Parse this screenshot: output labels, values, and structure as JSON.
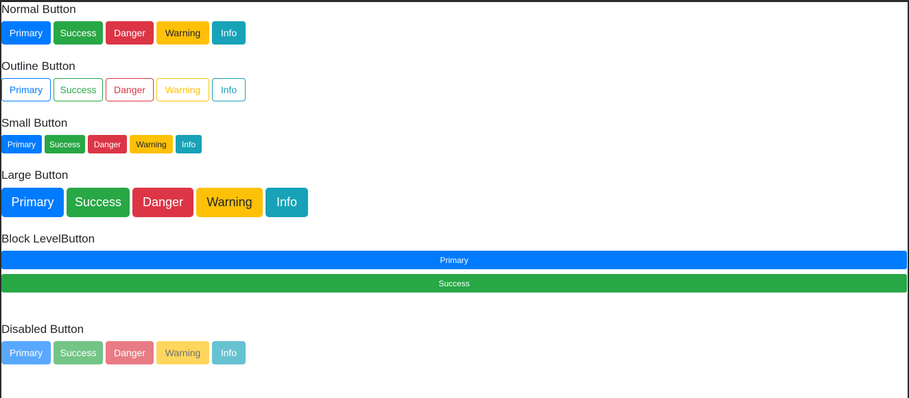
{
  "sections": {
    "normal": {
      "heading": "Normal Button"
    },
    "outline": {
      "heading": "Outline Button"
    },
    "small": {
      "heading": "Small Button"
    },
    "large": {
      "heading": "Large Button"
    },
    "block": {
      "heading": "Block LevelButton",
      "buttons": [
        "Primary",
        "Success"
      ]
    },
    "disabled": {
      "heading": "Disabled Button"
    }
  },
  "labels": [
    "Primary",
    "Success",
    "Danger",
    "Warning",
    "Info"
  ],
  "colors": {
    "primary": "#007bff",
    "success": "#28a745",
    "danger": "#dc3545",
    "warning": "#ffc107",
    "info": "#17a2b8"
  }
}
